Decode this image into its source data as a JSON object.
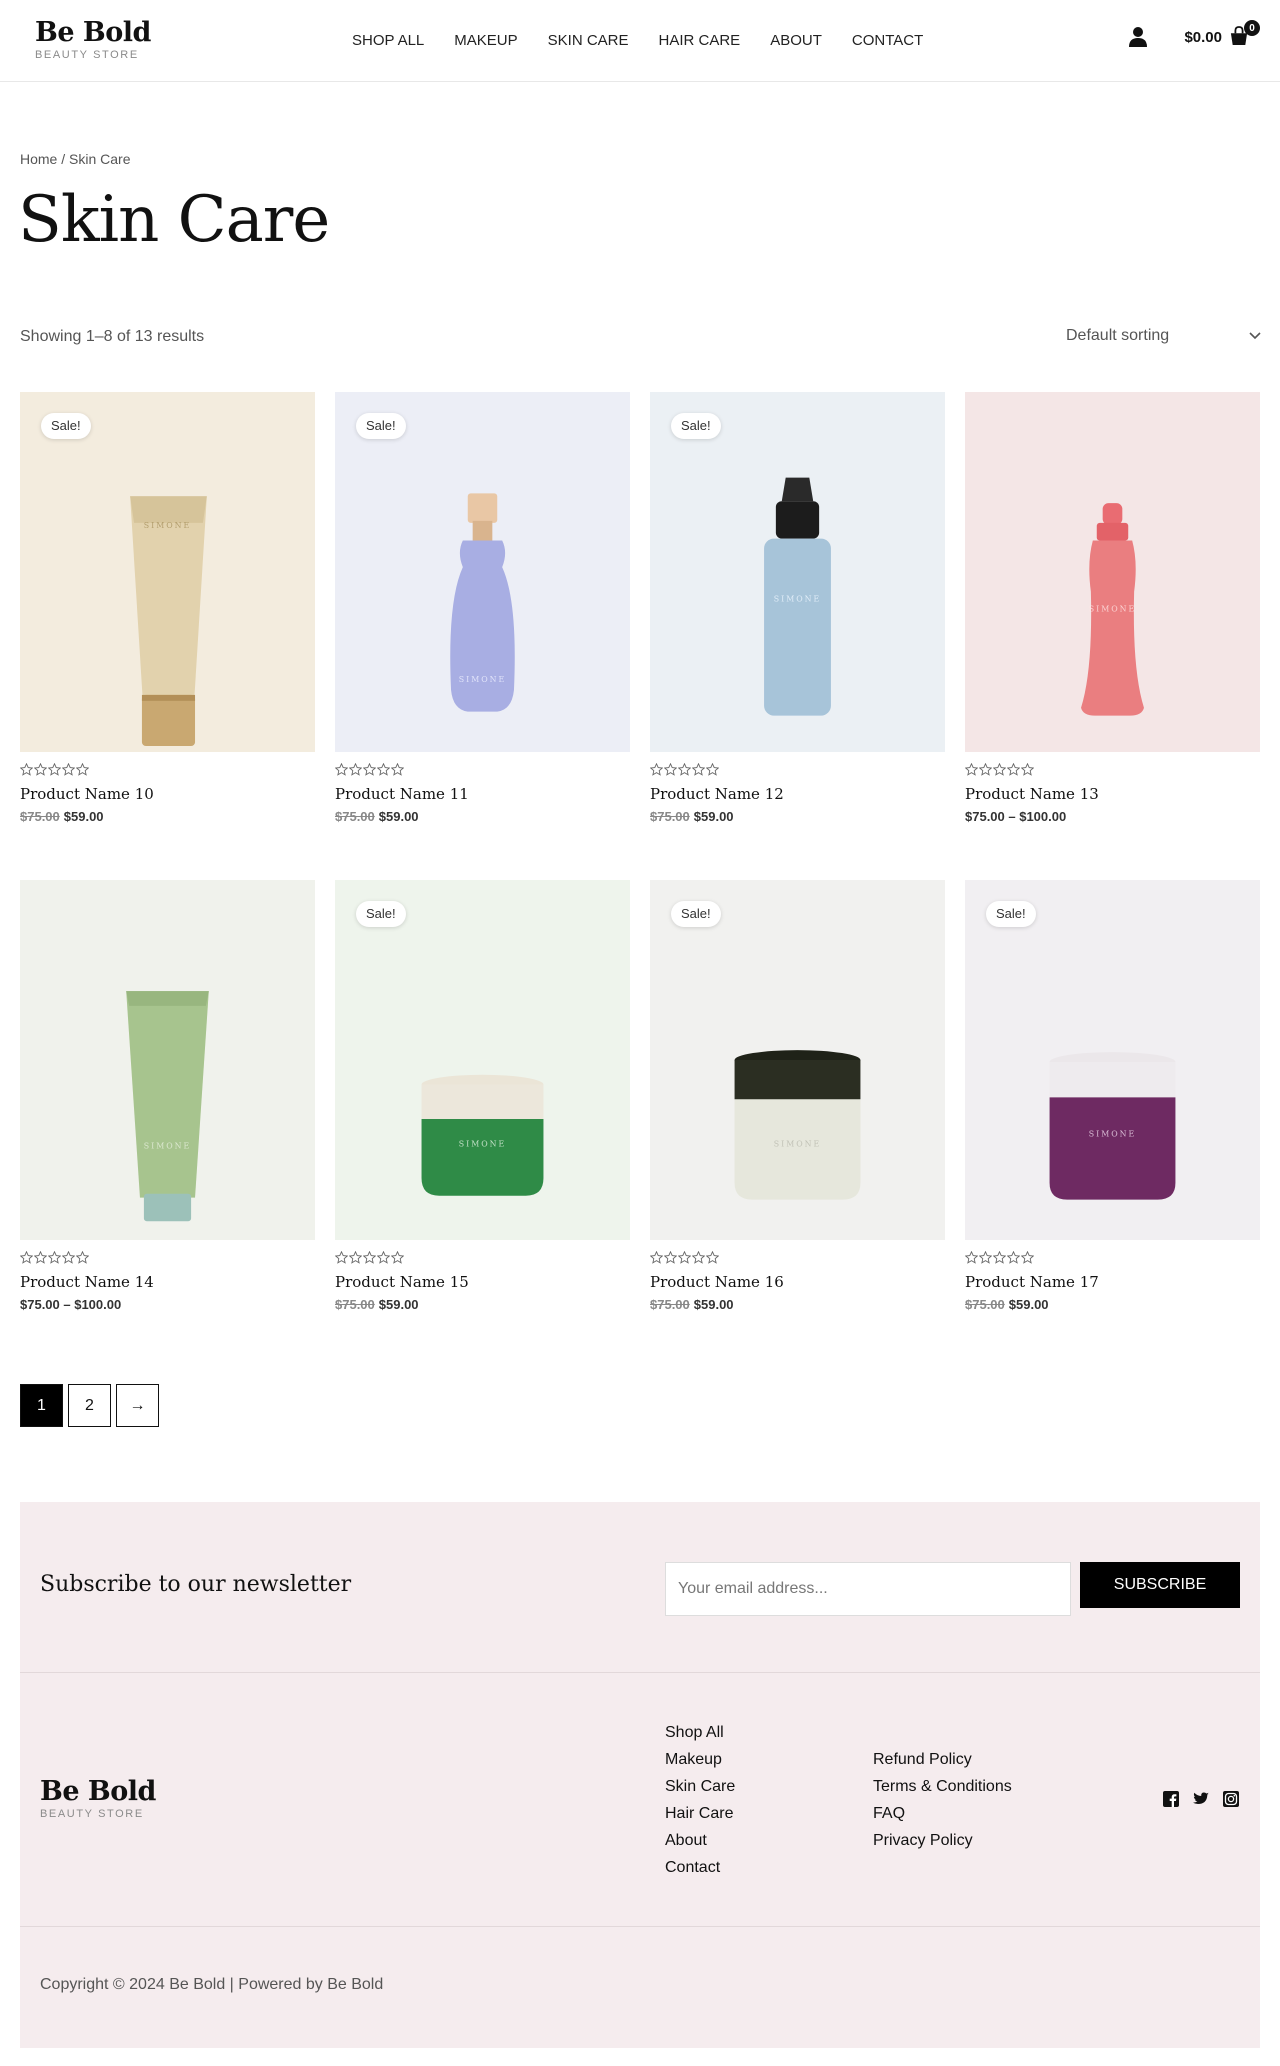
{
  "header": {
    "logo_main": "Be Bold",
    "logo_sub": "BEAUTY STORE",
    "nav": [
      "SHOP ALL",
      "MAKEUP",
      "SKIN CARE",
      "HAIR CARE",
      "ABOUT",
      "CONTACT"
    ],
    "cart_total": "$0.00",
    "cart_count": "0",
    "icons": [
      "user-icon",
      "shopping-bag-icon"
    ]
  },
  "breadcrumb": {
    "home": "Home",
    "separator": " / ",
    "current": "Skin Care"
  },
  "page_title": "Skin Care",
  "result_count": "Showing 1–8 of 13 results",
  "sorting": {
    "selected": "Default sorting"
  },
  "products": [
    {
      "name": "Product Name 10",
      "sale_badge": "Sale!",
      "old_price": "$75.00",
      "price": "$59.00",
      "bg": "#f3ecde",
      "item": "tube-beige"
    },
    {
      "name": "Product Name 11",
      "sale_badge": "Sale!",
      "old_price": "$75.00",
      "price": "$59.00",
      "bg": "#eceef6",
      "item": "spray-lavender"
    },
    {
      "name": "Product Name 12",
      "sale_badge": "Sale!",
      "old_price": "$75.00",
      "price": "$59.00",
      "bg": "#ebf0f4",
      "item": "dropper-blue"
    },
    {
      "name": "Product Name 13",
      "sale_badge": "",
      "old_price": "",
      "price": "$75.00 – $100.00",
      "bg": "#f4e6e6",
      "item": "dropper-pink"
    },
    {
      "name": "Product Name 14",
      "sale_badge": "",
      "old_price": "",
      "price": "$75.00 – $100.00",
      "bg": "#f0f2ec",
      "item": "tube-green"
    },
    {
      "name": "Product Name 15",
      "sale_badge": "Sale!",
      "old_price": "$75.00",
      "price": "$59.00",
      "bg": "#eef4ec",
      "item": "jar-green"
    },
    {
      "name": "Product Name 16",
      "sale_badge": "Sale!",
      "old_price": "$75.00",
      "price": "$59.00",
      "bg": "#f1f1ef",
      "item": "jar-white"
    },
    {
      "name": "Product Name 17",
      "sale_badge": "Sale!",
      "old_price": "$75.00",
      "price": "$59.00",
      "bg": "#f1eff2",
      "item": "jar-purple"
    }
  ],
  "product_label_text": "SIMONE",
  "pagination": {
    "pages": [
      "1",
      "2"
    ],
    "next": "→",
    "current": "1"
  },
  "footer": {
    "newsletter_title": "Subscribe to our newsletter",
    "email_placeholder": "Your email address...",
    "subscribe_label": "SUBSCRIBE",
    "logo_main": "Be Bold",
    "logo_sub": "BEAUTY STORE",
    "links_col1": [
      "Shop All",
      "Makeup",
      "Skin Care",
      "Hair Care",
      "About",
      "Contact"
    ],
    "links_col2": [
      "Refund Policy",
      "Terms & Conditions",
      "FAQ",
      "Privacy Policy"
    ],
    "social_icons": [
      "facebook-icon",
      "twitter-icon",
      "instagram-icon"
    ],
    "copyright": "Copyright © 2024 Be Bold | Powered by Be Bold"
  }
}
